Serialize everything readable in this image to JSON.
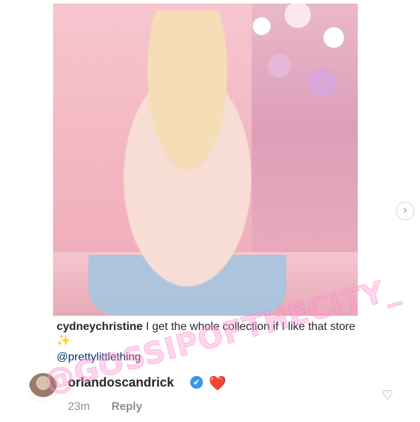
{
  "post": {
    "caption_user": "cydneychristine",
    "caption_text": "I get the whole collection if I like that store",
    "caption_emoji": "✨",
    "mention": "@prettylittlething"
  },
  "comment": {
    "username": "orlandoscandrick",
    "verified_badge": "✔",
    "emoji": "❤️",
    "time": "23m",
    "reply_label": "Reply"
  },
  "icons": {
    "next": "›",
    "like": "♡"
  },
  "watermark": "@GOSSIPOFTHECITY_",
  "colors": {
    "text": "#262626",
    "secondary": "#8e8e8e",
    "link": "#003569",
    "verified": "#3897f0",
    "heart": "#e0192b"
  }
}
